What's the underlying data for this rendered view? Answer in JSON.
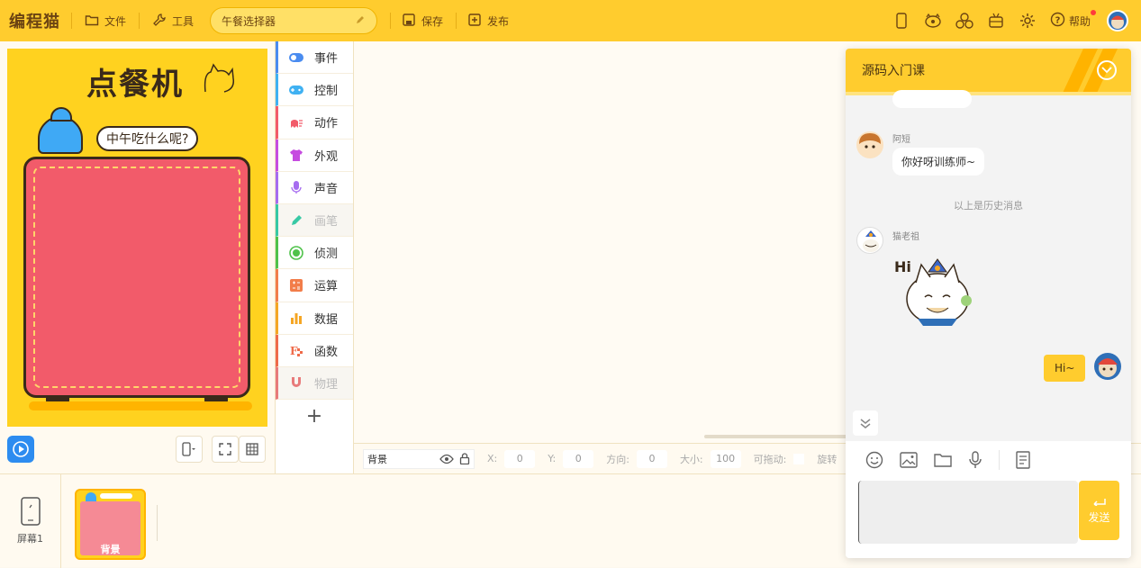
{
  "app": {
    "logo": "编程猫",
    "project_name": "午餐选择器"
  },
  "toolbar": {
    "file_label": "文件",
    "tools_label": "工具",
    "save_label": "保存",
    "publish_label": "发布",
    "help_label": "帮助"
  },
  "stage": {
    "title": "点餐机",
    "speech": "中午吃什么呢?"
  },
  "categories": [
    {
      "label": "事件",
      "color": "#4a8cf0",
      "enabled": true
    },
    {
      "label": "控制",
      "color": "#3fb1f2",
      "enabled": true
    },
    {
      "label": "动作",
      "color": "#f25b6a",
      "enabled": true
    },
    {
      "label": "外观",
      "color": "#c64ce0",
      "enabled": true
    },
    {
      "label": "声音",
      "color": "#a66cf0",
      "enabled": true
    },
    {
      "label": "画笔",
      "color": "#38c9a5",
      "enabled": false
    },
    {
      "label": "侦测",
      "color": "#4fc24a",
      "enabled": true
    },
    {
      "label": "运算",
      "color": "#f27d4a",
      "enabled": true
    },
    {
      "label": "数据",
      "color": "#f5a623",
      "enabled": true
    },
    {
      "label": "函数",
      "color": "#ef6b4a",
      "enabled": true
    },
    {
      "label": "物理",
      "color": "#e87b7b",
      "enabled": false
    }
  ],
  "properties": {
    "name": "背景",
    "x_label": "X:",
    "x_value": "0",
    "y_label": "Y:",
    "y_value": "0",
    "dir_label": "方向:",
    "dir_value": "0",
    "size_label": "大小:",
    "size_value": "100",
    "drag_label": "可拖动:",
    "rotate_label": "旋转"
  },
  "screens": {
    "screen_label": "屏幕1",
    "thumb_label": "背景"
  },
  "chat": {
    "title": "源码入门课",
    "messages": [
      {
        "sender": "阿短",
        "text": "你好呀训练师~"
      },
      {
        "sender": "猫老祖",
        "text": ""
      }
    ],
    "history_text": "以上是历史消息",
    "my_message": "Hi~",
    "sticker_text": "Hi",
    "input_value": "",
    "send_label": "发送"
  }
}
